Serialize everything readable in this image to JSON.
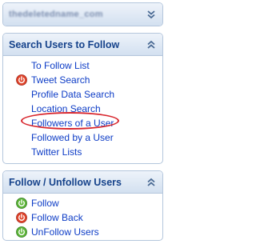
{
  "account_panel": {
    "title": "thedeletedname_com"
  },
  "search_panel": {
    "title": "Search Users to Follow",
    "items": [
      {
        "label": "To Follow List",
        "icon": "none"
      },
      {
        "label": "Tweet Search",
        "icon": "power-red-icon"
      },
      {
        "label": "Profile Data Search",
        "icon": "none"
      },
      {
        "label": "Location Search",
        "icon": "none"
      },
      {
        "label": "Followers of a User",
        "icon": "none",
        "highlighted": true
      },
      {
        "label": "Followed by a User",
        "icon": "none"
      },
      {
        "label": "Twitter Lists",
        "icon": "none"
      }
    ]
  },
  "follow_panel": {
    "title": "Follow / Unfollow Users",
    "items": [
      {
        "label": "Follow",
        "icon": "power-green-icon"
      },
      {
        "label": "Follow Back",
        "icon": "power-red-icon"
      },
      {
        "label": "UnFollow Users",
        "icon": "power-green-icon"
      }
    ]
  },
  "colors": {
    "header_text": "#15428b",
    "link_text": "#0d3cc6",
    "border": "#b4c6dc",
    "highlight_ring": "#d8252c",
    "power_red": "#e0452b",
    "power_green": "#5fb63a"
  }
}
